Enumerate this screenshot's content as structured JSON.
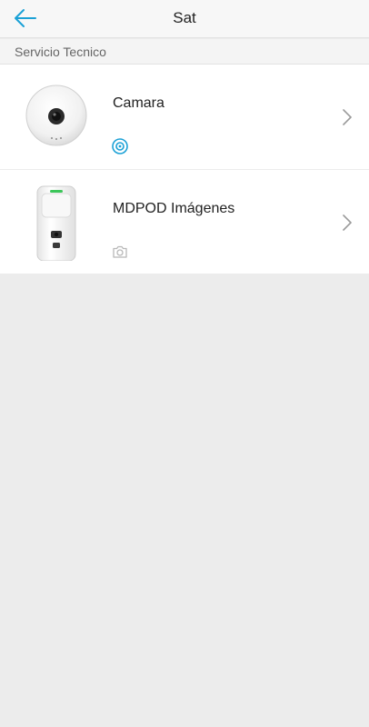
{
  "header": {
    "title": "Sat",
    "back_icon": "arrow-left-icon",
    "accent_color": "#1ba1d6"
  },
  "section": {
    "label": "Servicio Tecnico"
  },
  "devices": [
    {
      "name": "Camara",
      "image": "dome-camera-image",
      "status_icon": "camera-online-icon",
      "status_color": "#1ba1d6",
      "chevron_icon": "chevron-right-icon"
    },
    {
      "name": "MDPOD Imágenes",
      "image": "motion-detector-camera-image",
      "status_icon": "camera-icon",
      "status_color": "#b8b8b8",
      "chevron_icon": "chevron-right-icon"
    }
  ]
}
